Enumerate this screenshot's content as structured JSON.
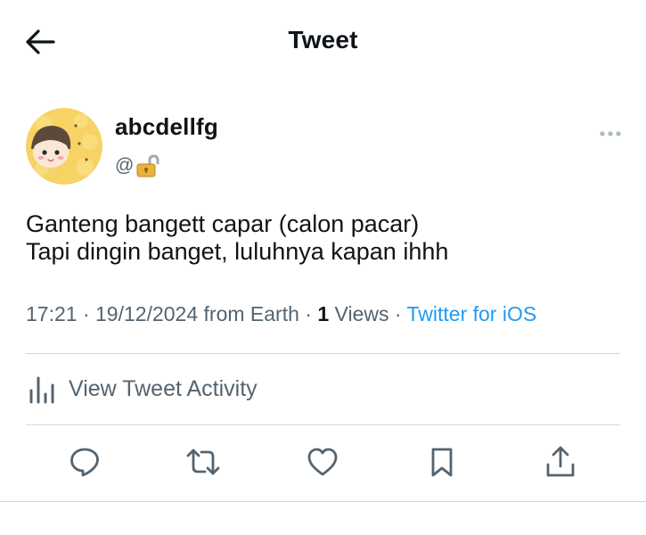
{
  "header": {
    "title": "Tweet",
    "back_icon": "arrow-left-icon"
  },
  "author": {
    "display_name": "abcdellfg",
    "handle_prefix": "@",
    "handle_icon": "lock-icon",
    "avatar_icon": "cartoon-avatar"
  },
  "tweet": {
    "lines": [
      "Ganteng bangett capar (calon pacar)",
      "Tapi dingin banget, luluhnya kapan ihhh"
    ]
  },
  "meta": {
    "time": "17:21",
    "sep1": " · ",
    "date": "19/12/2024 from Earth",
    "sep2": " · ",
    "views_count": "1",
    "views_label": " Views",
    "sep3": " · ",
    "client": "Twitter for iOS"
  },
  "activity": {
    "label": "View Tweet Activity",
    "icon": "bar-chart-icon"
  },
  "actions": {
    "reply_icon": "reply-icon",
    "retweet_icon": "retweet-icon",
    "like_icon": "heart-icon",
    "bookmark_icon": "bookmark-icon",
    "share_icon": "share-icon"
  },
  "colors": {
    "text_primary": "#0f1419",
    "text_secondary": "#536471",
    "link": "#1d9bf0",
    "divider": "#cfd9de"
  }
}
